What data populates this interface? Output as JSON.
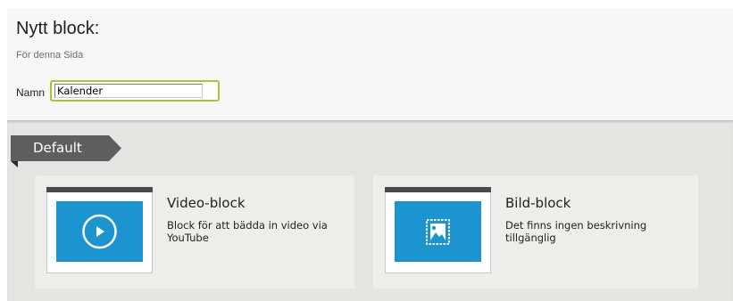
{
  "dialog": {
    "title": "Nytt block:",
    "subtitle": "För denna Sida",
    "name_label": "Namn",
    "name_value": "Kalender"
  },
  "group": {
    "label": "Default"
  },
  "blocks": [
    {
      "title": "Video-block",
      "description": "Block för att bädda in video via YouTube",
      "icon": "play-icon"
    },
    {
      "title": "Bild-block",
      "description": "Det finns ingen beskrivning tillgänglig",
      "icon": "image-icon"
    }
  ],
  "colors": {
    "accent_blue": "#1b94d0",
    "input_focus": "#a8c62f",
    "tag_bg": "#5e5e5e"
  }
}
